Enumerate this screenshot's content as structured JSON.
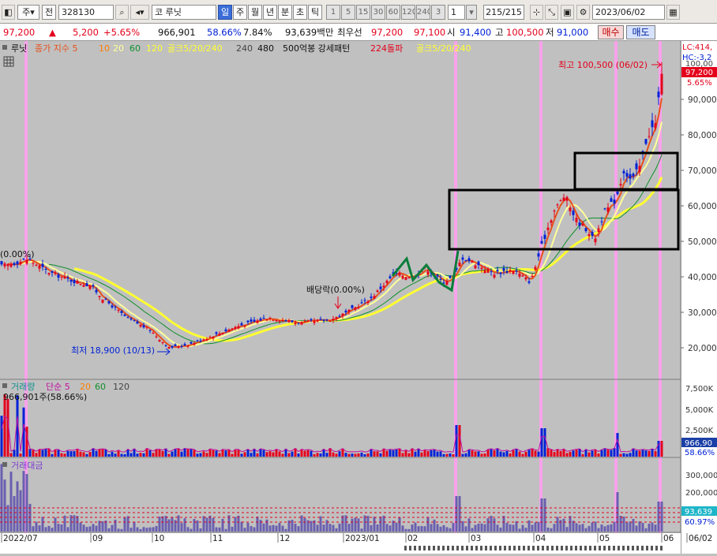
{
  "toolbar": {
    "market_type": "주",
    "prefix": "전",
    "code": "328130",
    "market_code": "코",
    "stock_name": "루닛",
    "periods": [
      "일",
      "주",
      "월",
      "년",
      "분",
      "초",
      "틱"
    ],
    "active_period": "일",
    "intervals": [
      "1",
      "5",
      "15",
      "30",
      "60",
      "120",
      "240",
      "3"
    ],
    "count_value": "1",
    "range": "215/215",
    "date": "2023/06/02"
  },
  "quote": {
    "price": "97,200",
    "change": "5,200",
    "change_pct": "+5.65%",
    "volume": "966,901",
    "volume_ratio": "58.66%",
    "turnover": "7.84%",
    "amount": "93,639백만",
    "best_bid_label": "최우선",
    "best_ask": "97,200",
    "best_bid": "97,100",
    "open_label": "시",
    "open": "91,400",
    "high_label": "고",
    "high": "100,500",
    "low_label": "저",
    "low": "91,000",
    "buy_label": "매수",
    "sell_label": "매도"
  },
  "legend": {
    "name": "루닛",
    "ma_title": "종가 지수 5",
    "ma10": "10",
    "ma20": "20",
    "ma60": "60",
    "ma120": "120",
    "gold_label": "골크5/20/240",
    "p240": "240",
    "p480": "480",
    "pattern_label": "500억봉 강세패턴",
    "dolpa_label": "224돌파",
    "gold_label2": "골크5/20/240"
  },
  "annotations": {
    "high": "최고 100,500 (06/02)",
    "low": "최저 18,900 (10/13)",
    "dividend": "배당락(0.00%)",
    "left_mark": "(0.00%)"
  },
  "price_axis": {
    "ticks": [
      "90,000",
      "80,000",
      "70,000",
      "60,000",
      "50,000",
      "40,000",
      "30,000",
      "20,000"
    ],
    "lc": "LC:414,",
    "hc": "HC:-3,2",
    "top_cut": "100,00",
    "current": "97,200",
    "pct": "5.65%"
  },
  "volume_panel": {
    "title": "거래량",
    "ma_title": "단순 5",
    "ma20": "20",
    "ma60": "60",
    "ma120": "120",
    "info": "966,901주(58.66%)",
    "ticks": [
      "7,500K",
      "5,000K",
      "2,500K"
    ],
    "current": "966,90",
    "pct": "58.66%"
  },
  "amount_panel": {
    "title": "거래대금",
    "ticks": [
      "300,000",
      "200,000"
    ],
    "current": "93,639",
    "pct": "60.97%"
  },
  "date_axis": {
    "labels": [
      "2022/07",
      "09",
      "10",
      "11",
      "12",
      "2023/01",
      "02",
      "03",
      "04",
      "05",
      "06",
      "06/02"
    ]
  },
  "colors": {
    "up": "#e4001b",
    "down": "#0021d6",
    "ma5": "#e8501a",
    "ma20": "#ffff99",
    "ma60": "#0f8f2a",
    "ma120": "#ffff33",
    "highlight": "#ff9ff0"
  }
}
